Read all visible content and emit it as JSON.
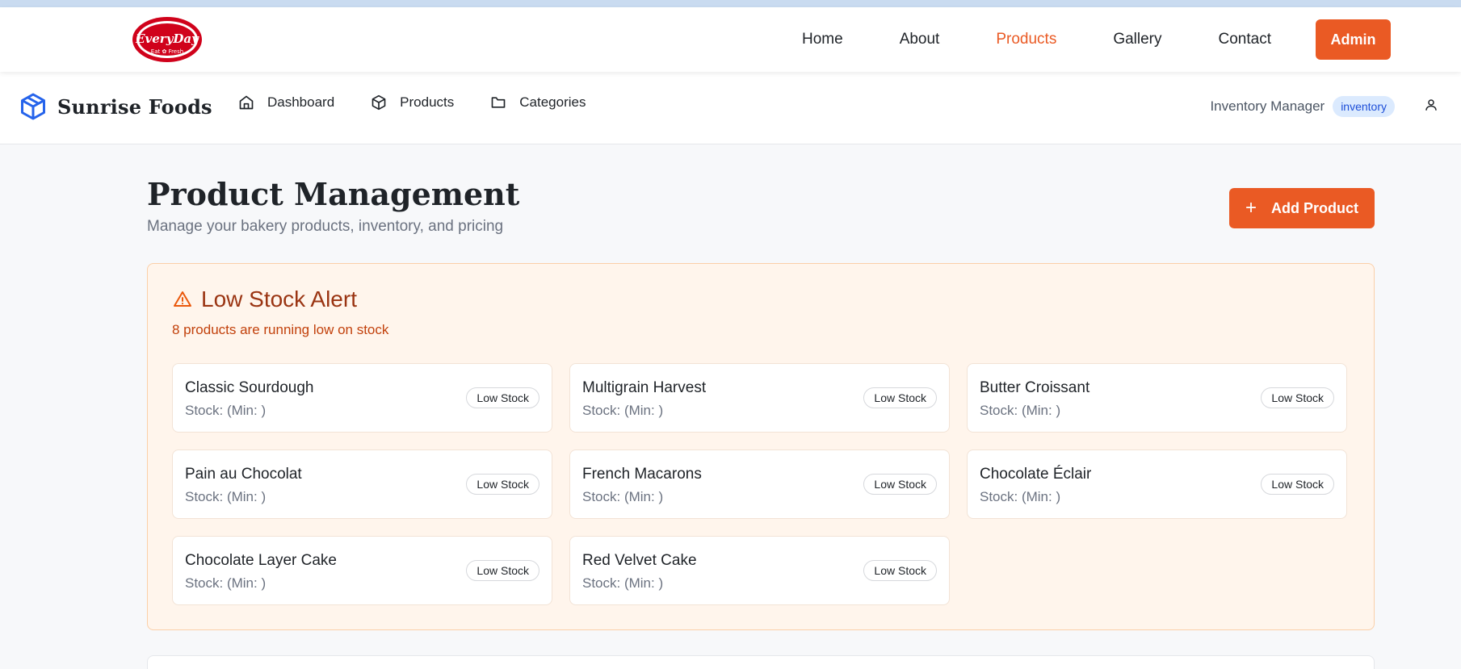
{
  "site_nav": {
    "logo_text": "EveryDay",
    "logo_tagline": "Eat Fresh",
    "items": [
      {
        "label": "Home",
        "active": false
      },
      {
        "label": "About",
        "active": false
      },
      {
        "label": "Products",
        "active": true
      },
      {
        "label": "Gallery",
        "active": false
      },
      {
        "label": "Contact",
        "active": false
      }
    ],
    "admin_label": "Admin"
  },
  "app_bar": {
    "brand": "Sunrise Foods",
    "brand_icon": "box-icon",
    "nav": [
      {
        "label": "Dashboard",
        "icon": "home-icon"
      },
      {
        "label": "Products",
        "icon": "package-icon"
      },
      {
        "label": "Categories",
        "icon": "folder-icon"
      }
    ],
    "user_label": "Inventory Manager",
    "role_badge": "inventory",
    "user_icon": "user-icon"
  },
  "page": {
    "title": "Product Management",
    "subtitle": "Manage your bakery products, inventory, and pricing",
    "add_button": "Add Product"
  },
  "alert": {
    "icon": "warning-triangle-icon",
    "title": "Low Stock Alert",
    "description": "8 products are running low on stock",
    "items": [
      {
        "name": "Classic Sourdough",
        "stock": "Stock: (Min: )",
        "badge": "Low Stock"
      },
      {
        "name": "Multigrain Harvest",
        "stock": "Stock: (Min: )",
        "badge": "Low Stock"
      },
      {
        "name": "Butter Croissant",
        "stock": "Stock: (Min: )",
        "badge": "Low Stock"
      },
      {
        "name": "Pain au Chocolat",
        "stock": "Stock: (Min: )",
        "badge": "Low Stock"
      },
      {
        "name": "French Macarons",
        "stock": "Stock: (Min: )",
        "badge": "Low Stock"
      },
      {
        "name": "Chocolate Éclair",
        "stock": "Stock: (Min: )",
        "badge": "Low Stock"
      },
      {
        "name": "Chocolate Layer Cake",
        "stock": "Stock: (Min: )",
        "badge": "Low Stock"
      },
      {
        "name": "Red Velvet Cake",
        "stock": "Stock: (Min: )",
        "badge": "Low Stock"
      }
    ]
  },
  "colors": {
    "accent": "#ea5a24",
    "alert_bg": "#fff5ec",
    "alert_text": "#9a3412",
    "badge_bg": "#dbeafe",
    "brand_icon": "#2563eb"
  }
}
